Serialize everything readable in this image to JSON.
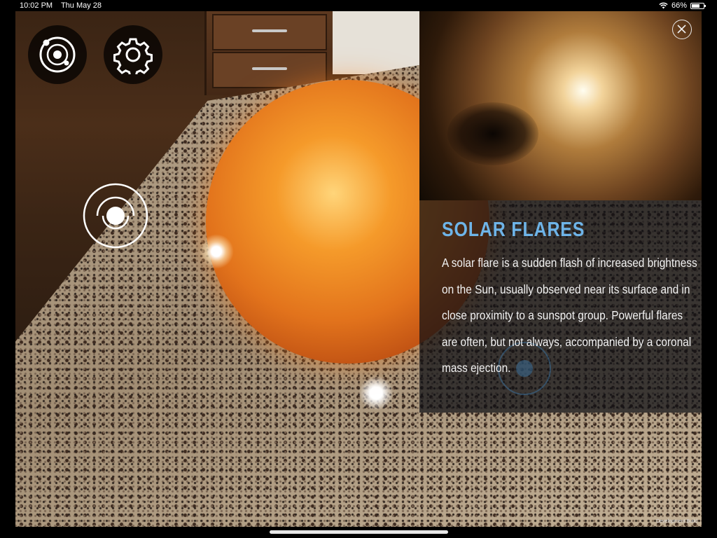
{
  "status_bar": {
    "time": "10:02 PM",
    "date": "Thu May 28",
    "battery": "66%",
    "battery_level": 0.66,
    "wifi_icon": "wifi-icon",
    "battery_icon": "battery-icon"
  },
  "toolbar": {
    "orbit_icon": "solar-system-icon",
    "settings_icon": "gear-icon"
  },
  "scene": {
    "marker_icon": "target-marker-icon"
  },
  "info": {
    "title": "SOLAR FLARES",
    "body": "A solar flare is a sudden flash of increased brightness on the Sun, usually observed near its surface and in close proximity to a sunspot group. Powerful flares are often, but not always, accompanied by a coronal mass ejection.",
    "close_icon": "close-icon",
    "title_color": "#6eb4e8"
  },
  "footer": {
    "dev_build": "Development Build"
  }
}
